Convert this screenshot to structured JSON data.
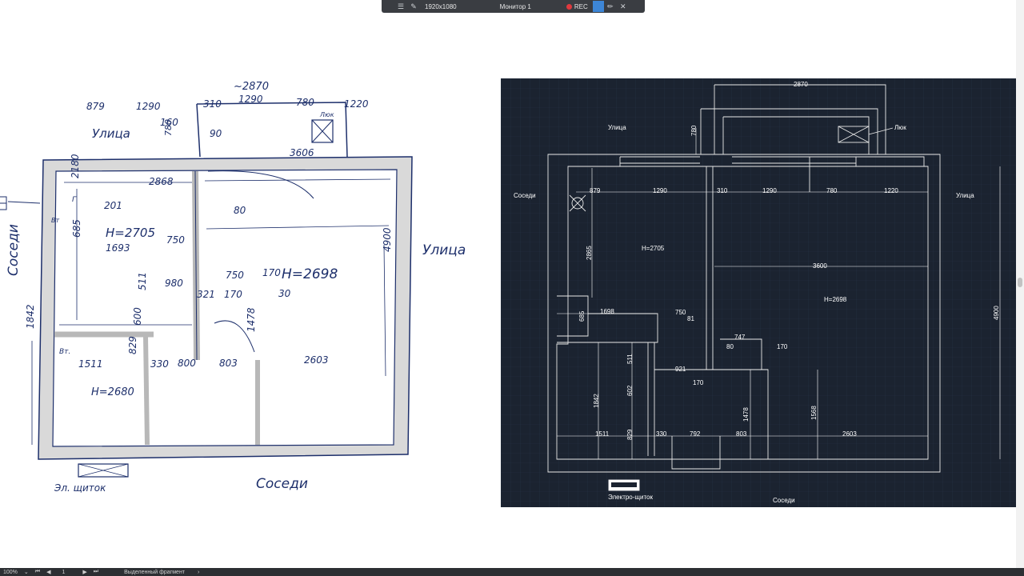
{
  "toolbar": {
    "resolution": "1920x1080",
    "monitor": "Монитор 1",
    "rec_label": "REC",
    "icons": [
      "menu-icon",
      "pin-icon",
      "record-icon",
      "square-icon",
      "pencil-icon",
      "close-icon"
    ]
  },
  "sketch": {
    "labels": {
      "street_top": "Улица",
      "street_right": "Улица",
      "neighbors_left": "Соседи",
      "neighbors_bottom": "Соседи",
      "el_panel": "Эл. щиток",
      "hatch": "Люк",
      "balcony_width": "~2870",
      "balcony_depth": "780",
      "h_room1": "H=2705",
      "h_room2": "H=2698",
      "h_bath": "H=2680",
      "bath_tag": "Вт.",
      "outlet_tag": "Вт",
      "riser_tag": "Г"
    },
    "dims": [
      "879",
      "1290",
      "160",
      "310",
      "1290",
      "780",
      "1220",
      "90",
      "3606",
      "2180",
      "2868",
      "201",
      "685",
      "1693",
      "750",
      "980",
      "4900",
      "750",
      "170",
      "321",
      "170",
      "80",
      "30",
      "1842",
      "511",
      "600",
      "829",
      "1511",
      "330",
      "800",
      "803",
      "1478",
      "2603"
    ]
  },
  "cad": {
    "labels": {
      "street_top": "Улица",
      "street_right": "Улица",
      "neighbors_left": "Соседи",
      "neighbors_bottom": "Соседи",
      "hatch": "Люк",
      "el_panel": "Электро-щиток",
      "h_room1": "H=2705",
      "h_room2": "H=2698"
    },
    "dims": [
      "2870",
      "780",
      "879",
      "1290",
      "310",
      "1290",
      "780",
      "1220",
      "2865",
      "3600",
      "4900",
      "1698",
      "750",
      "81",
      "685",
      "747",
      "80",
      "170",
      "921",
      "170",
      "511",
      "1842",
      "602",
      "1478",
      "1568",
      "1511",
      "829",
      "330",
      "792",
      "803",
      "2603"
    ]
  },
  "status": {
    "zoom": "100%",
    "page": "1",
    "selection": "Выделенный фрагмент"
  }
}
